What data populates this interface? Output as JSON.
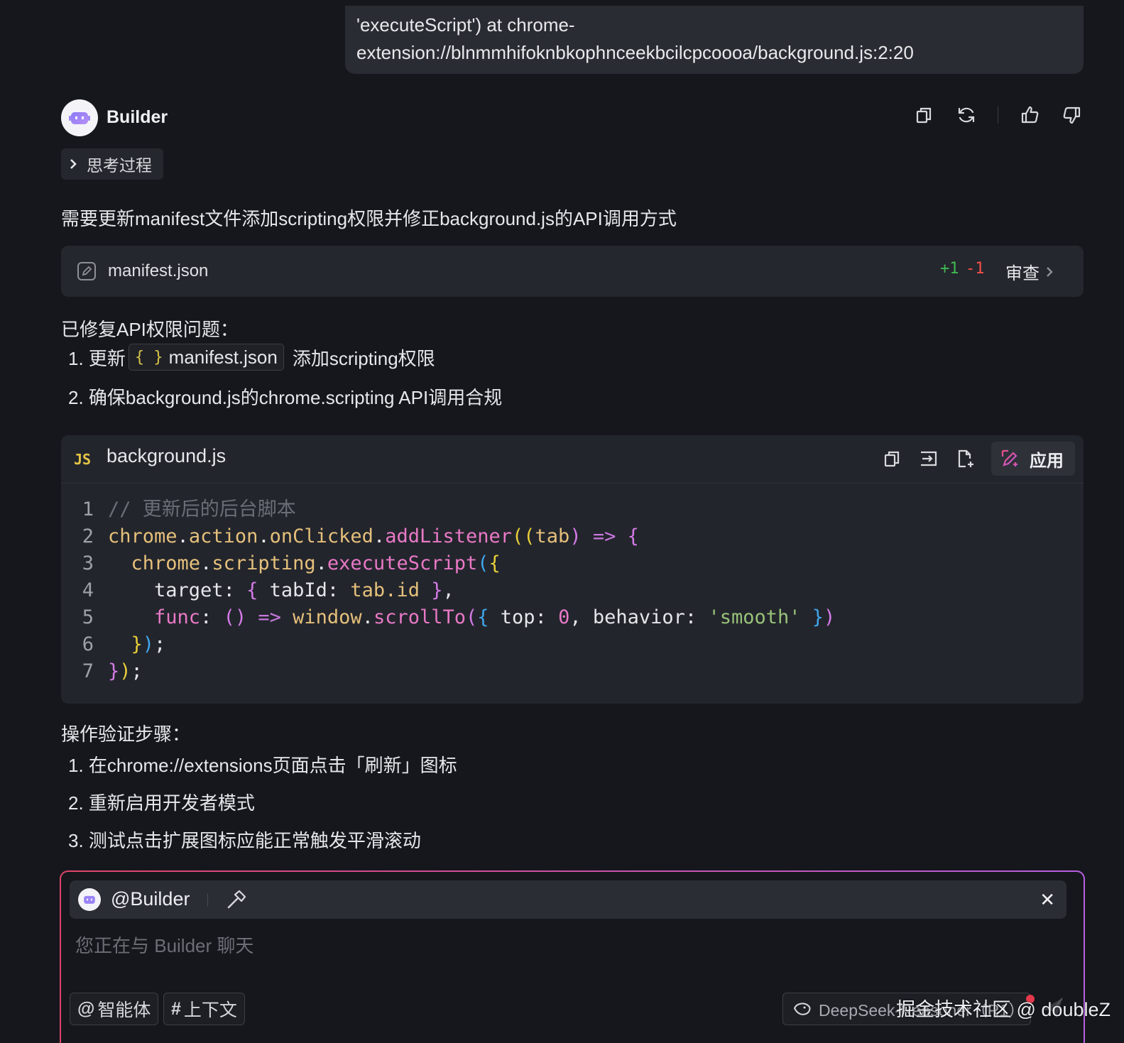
{
  "user_message": {
    "line1": "'executeScript') at chrome-",
    "line2": "extension://blnmmhifoknbkophnceekbcilcpcoooa/background.js:2:20"
  },
  "assistant": {
    "name": "Builder",
    "thinking_label": "思考过程",
    "intro": "需要更新manifest文件添加scripting权限并修正background.js的API调用方式",
    "actions": [
      "copy-icon",
      "refresh-icon",
      "thumbs-up-icon",
      "thumbs-down-icon"
    ]
  },
  "file_change": {
    "filename": "manifest.json",
    "additions": "+1",
    "deletions": "-1",
    "review_label": "审查"
  },
  "fix_summary": {
    "heading": "已修复API权限问题：",
    "item1_prefix": "1. 更新",
    "item1_chip": "manifest.json",
    "item1_chip_icon": "{ }",
    "item1_suffix": "添加scripting权限",
    "item2": "2. 确保background.js的chrome.scripting API调用合规"
  },
  "code_block": {
    "lang_badge": "JS",
    "filename": "background.js",
    "apply_label": "应用",
    "line_numbers": [
      "1",
      "2",
      "3",
      "4",
      "5",
      "6",
      "7"
    ],
    "tokens": {
      "l1_comment": "// 更新后的后台脚本",
      "chrome": "chrome",
      "dot": ".",
      "action": "action",
      "onClicked": "onClicked",
      "addListener": "addListener",
      "tab": "tab",
      "arrow": "=>",
      "scripting": "scripting",
      "executeScript": "executeScript",
      "target": "target",
      "tabId": "tabId",
      "tab_id": "tab.id",
      "func": "func",
      "window": "window",
      "scrollTo": "scrollTo",
      "top": "top",
      "zero": "0",
      "behavior": "behavior",
      "smooth": "'smooth'"
    }
  },
  "verify_steps": {
    "heading": "操作验证步骤：",
    "items": [
      "1. 在chrome://extensions页面点击「刷新」图标",
      "2. 重新启用开发者模式",
      "3. 测试点击扩展图标应能正常触发平滑滚动"
    ]
  },
  "chat_input": {
    "mention": "@Builder",
    "placeholder": "您正在与 Builder 聊天",
    "agent_chip": "智能体",
    "context_chip": "上下文",
    "model": "DeepSeek-Reasoner（R1）"
  },
  "watermark": "掘金技术社区 @ doubleZ",
  "colors": {
    "background": "#16171d",
    "card": "#25272e",
    "additions": "#3fb950",
    "deletions": "#f85149",
    "input_border_start": "#e0456a",
    "input_border_end": "#b65fe0"
  }
}
